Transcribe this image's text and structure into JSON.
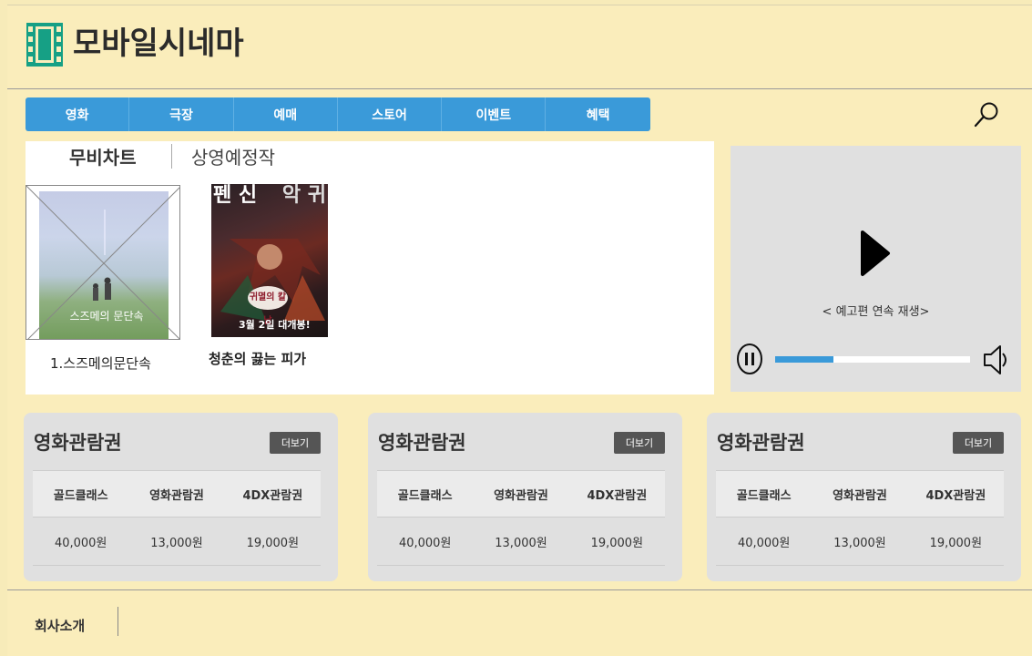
{
  "header": {
    "logo_text": "모바일시네마",
    "logo_icon": "film-strip-icon"
  },
  "nav": {
    "items": [
      "영화",
      "극장",
      "예매",
      "스토어",
      "이벤트",
      "혜택"
    ]
  },
  "chart_tabs": {
    "active": "무비차트",
    "other": "상영예정작"
  },
  "movies": [
    {
      "label": "1.스즈메의문단속",
      "poster_title": "스즈메의 문단속"
    },
    {
      "label": "청춘의 끓는 피가",
      "poster_left": "펜 신",
      "poster_right": "악 귀",
      "poster_badge": "귀멸의 칼날",
      "poster_date": "3월 2일 대개봉!"
    }
  ],
  "video": {
    "caption": "< 예고편 연속 재생>",
    "progress": 0.3
  },
  "tickets": [
    {
      "title": "영화관람권",
      "more": "더보기",
      "headers": [
        "골드클래스",
        "영화관람권",
        "4DX관람권"
      ],
      "prices": [
        "40,000원",
        "13,000원",
        "19,000원"
      ]
    },
    {
      "title": "영화관람권",
      "more": "더보기",
      "headers": [
        "골드클래스",
        "영화관람권",
        "4DX관람권"
      ],
      "prices": [
        "40,000원",
        "13,000원",
        "19,000원"
      ]
    },
    {
      "title": "영화관람권",
      "more": "더보기",
      "headers": [
        "골드클래스",
        "영화관람권",
        "4DX관람권"
      ],
      "prices": [
        "40,000원",
        "13,000원",
        "19,000원"
      ]
    }
  ],
  "footer": {
    "link": "회사소개"
  },
  "colors": {
    "background": "#faedbb",
    "accent": "#3a9ad9",
    "panel": "#e0e0e0"
  }
}
